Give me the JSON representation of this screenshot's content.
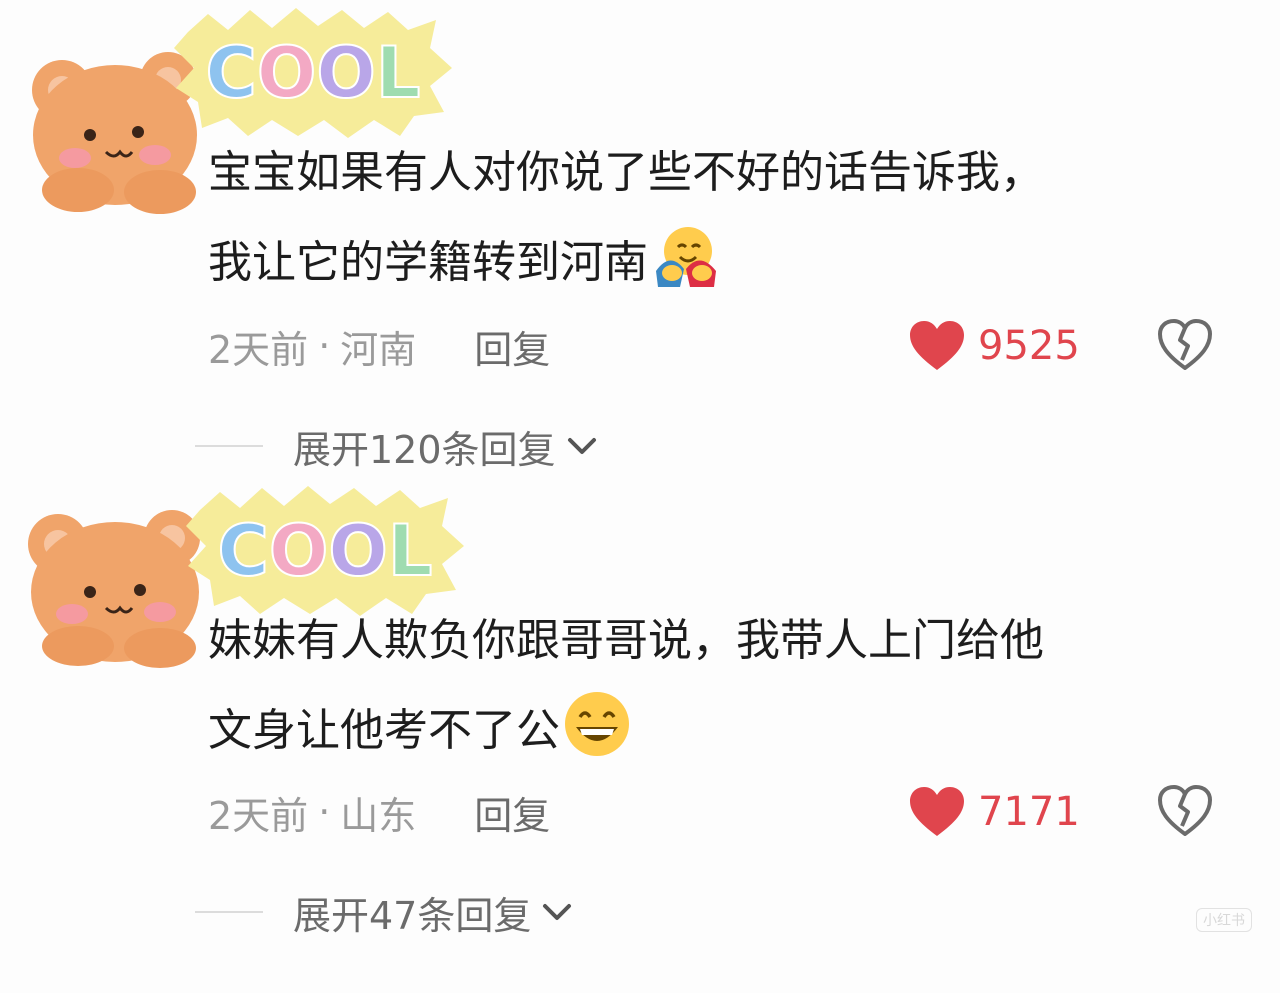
{
  "comments": [
    {
      "text_line1": "宝宝如果有人对你说了些不好的话告诉我，",
      "text_line2": "我让它的学籍转到河南",
      "time": "2天前",
      "separator": "·",
      "location": "河南",
      "reply_label": "回复",
      "likes": "9525",
      "expand_label": "展开120条回复",
      "badge_text": "COOL",
      "emoji": "hugging-face-emoji"
    },
    {
      "text_line1": "妹妹有人欺负你跟哥哥说，我带人上门给他",
      "text_line2": "文身让他考不了公",
      "time": "2天前",
      "separator": "·",
      "location": "山东",
      "reply_label": "回复",
      "likes": "7171",
      "expand_label": "展开47条回复",
      "badge_text": "COOL",
      "emoji": "grinning-face-emoji"
    }
  ],
  "watermark": "小红书",
  "colors": {
    "like_red": "#e0454d",
    "bear_orange": "#f0a46a",
    "badge_yellow": "#f6ec9a",
    "meta_gray": "#9a9a9a"
  }
}
